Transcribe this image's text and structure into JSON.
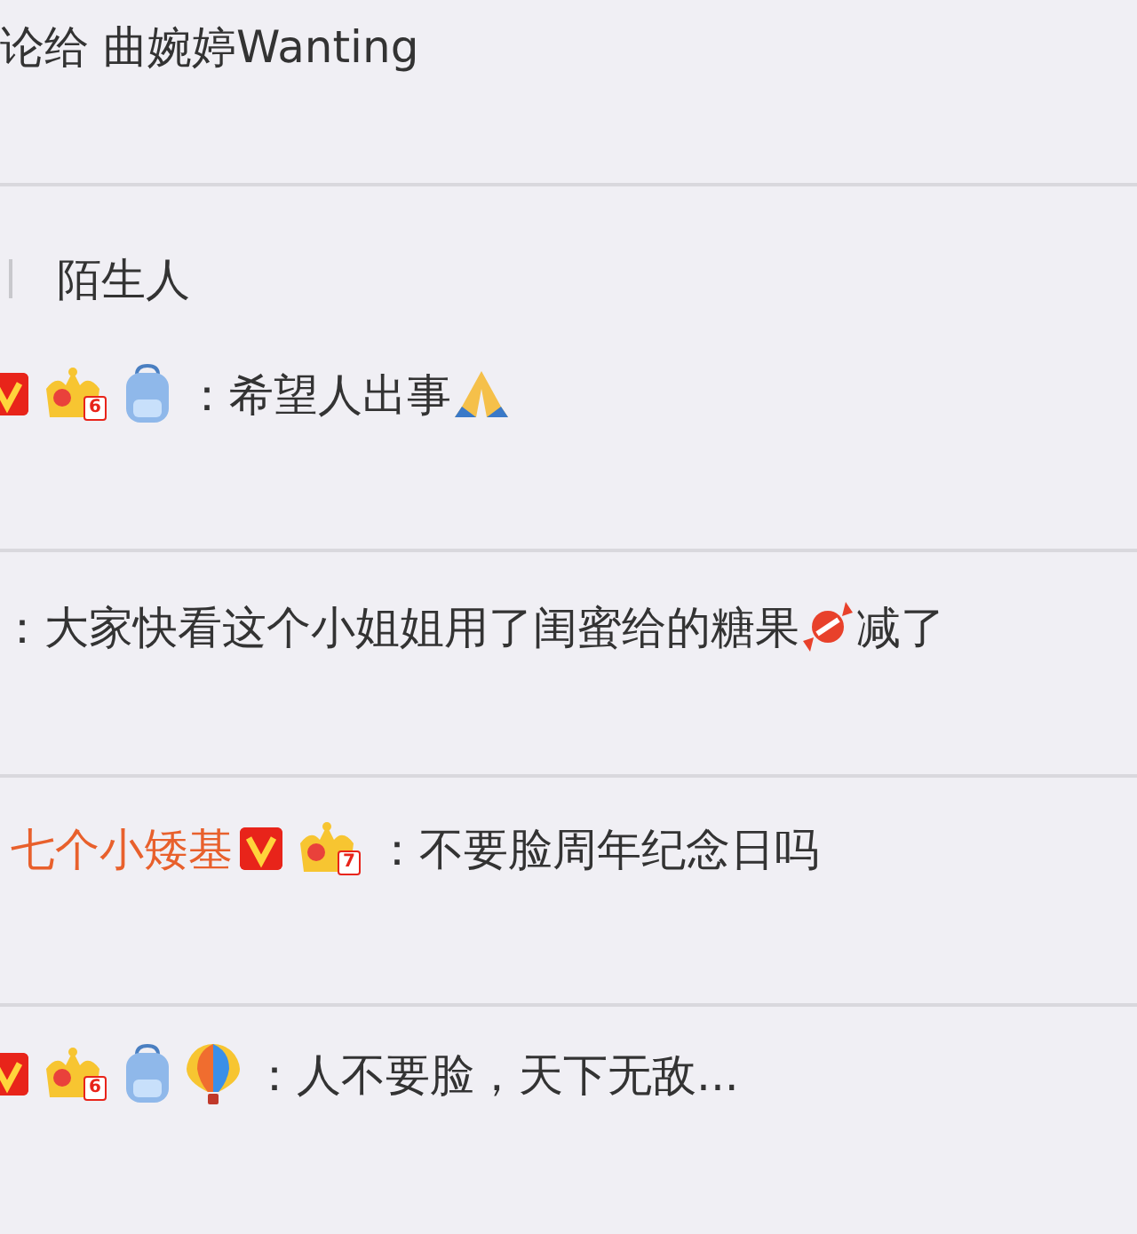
{
  "blocks": [
    {
      "lines": [
        [
          {
            "kind": "text",
            "text": "论给 曲婉婷Wanting"
          }
        ]
      ]
    },
    {
      "lines": [
        [
          {
            "kind": "bar"
          },
          {
            "kind": "text",
            "text": "陌生人"
          }
        ],
        [
          {
            "kind": "vip"
          },
          {
            "kind": "crown",
            "digit": "6"
          },
          {
            "kind": "backpack"
          },
          {
            "kind": "text",
            "text": "：希望人出事"
          },
          {
            "kind": "pray"
          }
        ]
      ]
    },
    {
      "lines": [
        [
          {
            "kind": "text",
            "text": "：大家快看这个小姐姐用了闺蜜给的糖果"
          },
          {
            "kind": "candy"
          },
          {
            "kind": "text",
            "text": "减了"
          }
        ]
      ]
    },
    {
      "lines": [
        [
          {
            "kind": "name",
            "text": "七个小矮基"
          },
          {
            "kind": "vip"
          },
          {
            "kind": "crown",
            "digit": "7"
          },
          {
            "kind": "text",
            "text": "：不要脸周年纪念日吗"
          }
        ]
      ]
    },
    {
      "lines": [
        [
          {
            "kind": "vip"
          },
          {
            "kind": "crown",
            "digit": "6"
          },
          {
            "kind": "backpack"
          },
          {
            "kind": "balloon"
          },
          {
            "kind": "text",
            "text": "：人不要脸，天下无敌..."
          }
        ]
      ]
    }
  ]
}
